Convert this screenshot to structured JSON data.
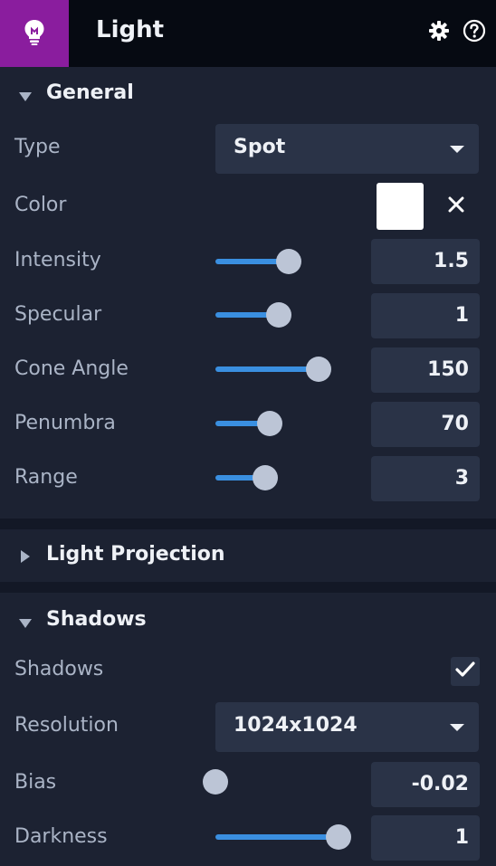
{
  "header": {
    "title": "Light",
    "icon": "lightbulb-icon",
    "settings_icon": "gear-icon",
    "help_icon": "help-icon"
  },
  "general": {
    "title": "General",
    "expanded": true,
    "type": {
      "label": "Type",
      "value": "Spot"
    },
    "color": {
      "label": "Color",
      "value": "#ffffff"
    },
    "intensity": {
      "label": "Intensity",
      "value": "1.5",
      "slider_fraction": 0.55
    },
    "specular": {
      "label": "Specular",
      "value": "1",
      "slider_fraction": 0.46
    },
    "cone_angle": {
      "label": "Cone Angle",
      "value": "150",
      "slider_fraction": 0.82
    },
    "penumbra": {
      "label": "Penumbra",
      "value": "70",
      "slider_fraction": 0.38
    },
    "range": {
      "label": "Range",
      "value": "3",
      "slider_fraction": 0.34
    }
  },
  "light_projection": {
    "title": "Light Projection",
    "expanded": false
  },
  "shadows": {
    "title": "Shadows",
    "expanded": true,
    "enabled": {
      "label": "Shadows",
      "checked": true
    },
    "resolution": {
      "label": "Resolution",
      "value": "1024x1024"
    },
    "bias": {
      "label": "Bias",
      "value": "-0.02",
      "slider_fraction": 0.0
    },
    "darkness": {
      "label": "Darkness",
      "value": "1",
      "slider_fraction": 1.0
    }
  },
  "colors": {
    "accent": "#3a8fe0",
    "header_icon_bg": "#8a1d9e",
    "panel_bg": "#1c2232",
    "field_bg": "#2a3347"
  }
}
